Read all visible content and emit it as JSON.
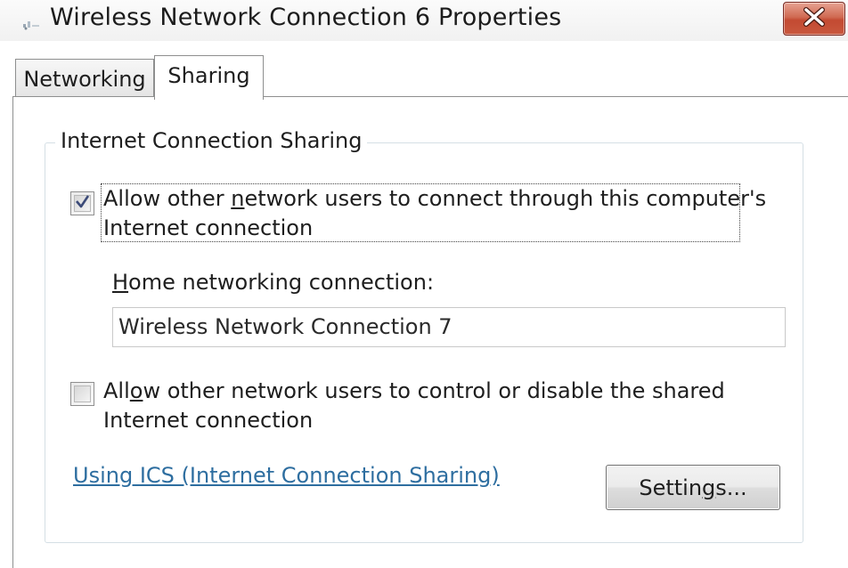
{
  "window": {
    "title": "Wireless Network Connection 6 Properties",
    "icon": "network-connection-icon",
    "close_icon": "close-x-icon",
    "close_color": "#c9583e"
  },
  "tabs": [
    {
      "label": "Networking",
      "selected": false
    },
    {
      "label": "Sharing",
      "selected": true
    }
  ],
  "ics_group": {
    "legend": "Internet Connection Sharing",
    "allow_connect": {
      "checked": true,
      "line1_pre": "Allow other ",
      "line1_mnemonic": "n",
      "line1_post": "etwork users to connect through this computer's",
      "line2": "Internet connection"
    },
    "home_connection": {
      "label_mnemonic": "H",
      "label_rest": "ome networking connection:",
      "value": "Wireless Network Connection 7"
    },
    "allow_control": {
      "checked": false,
      "line1_pre": "All",
      "line1_mnemonic": "o",
      "line1_post": "w other network users to control or disable the shared",
      "line2": "Internet connection"
    },
    "help_link": "Using ICS (Internet Connection Sharing)",
    "settings_button": {
      "label_pre": "Settin",
      "label_mnemonic": "g",
      "label_post": "s..."
    }
  },
  "colors": {
    "link": "#2e6ea0",
    "border": "#8e8f8f",
    "groupbox_border": "#d5dfe5",
    "checkmark": "#3b4a78"
  }
}
